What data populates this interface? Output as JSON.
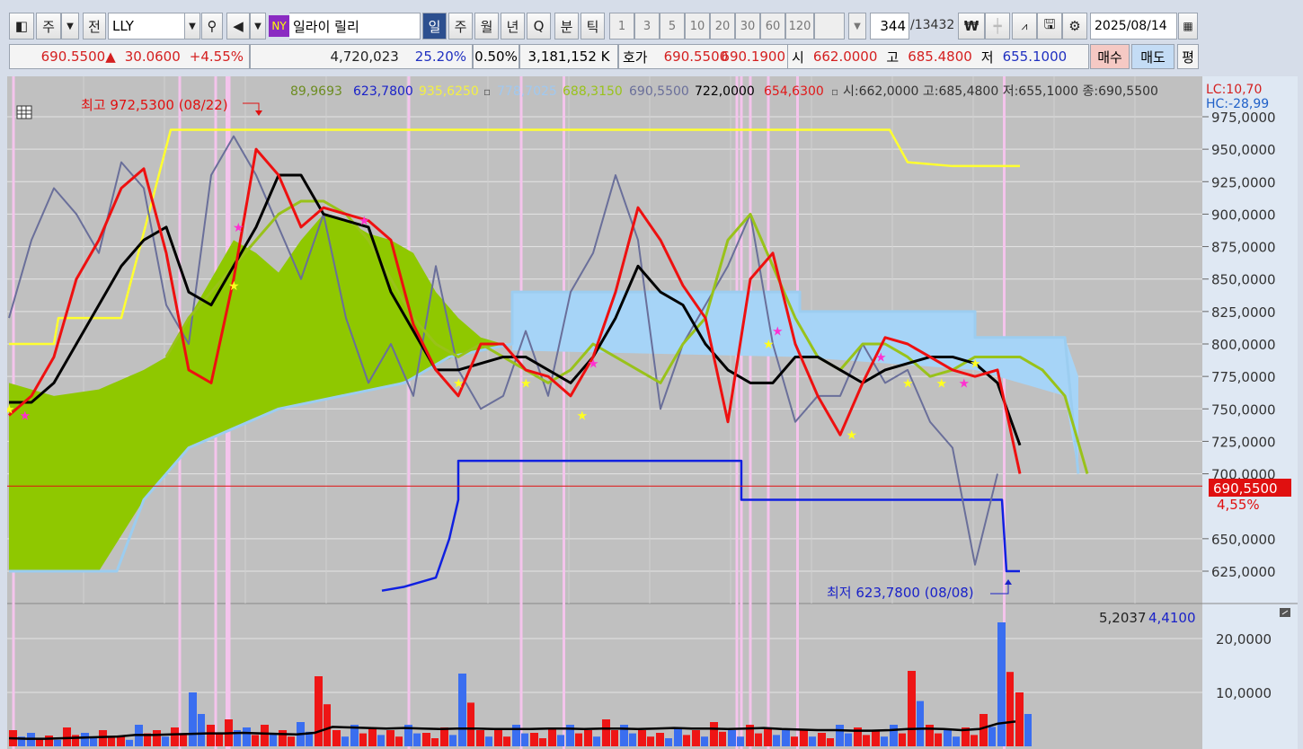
{
  "toolbar": {
    "period_label": "주",
    "prev_label": "전",
    "symbol": "LLY",
    "exchange_badge": "NY",
    "name": "일라이 릴리",
    "period_tabs": [
      "일",
      "주",
      "월",
      "년",
      "Q",
      "분",
      "틱"
    ],
    "intervals": [
      "1",
      "3",
      "5",
      "10",
      "20",
      "30",
      "60",
      "120"
    ],
    "count_value": "344",
    "count_total": "/13432",
    "currency_icon": "₩",
    "date": "2025/08/14"
  },
  "quote": {
    "price": "690.5500",
    "arrow": "▲",
    "change": "30.0600",
    "change_pct": "+4.55%",
    "volume": "4,720,023",
    "vol_ratio": "25.20%",
    "turnover": "0.50%",
    "amount": "3,181,152 K",
    "bid_label": "호가",
    "bid": "690.5500",
    "ask": "690.1900",
    "open_label": "시",
    "open": "662.0000",
    "high_label": "고",
    "high": "685.4800",
    "low_label": "저",
    "low": "655.1000",
    "buy_label": "매수",
    "sell_label": "매도",
    "avg_label": "평"
  },
  "legend": {
    "v1": "89,9693",
    "v2": "623,7800",
    "v3": "935,6250",
    "v4": "778,7025",
    "v5": "688,3150",
    "v6": "690,5500",
    "v7": "722,0000",
    "v8": "654,6300",
    "ohlc": "시:662,0000 고:685,4800 저:655,1000 종:690,5500",
    "lc": "LC:10,70",
    "hc": "HC:-28,99"
  },
  "annotations": {
    "high": "최고 972,5300 (08/22)",
    "low": "최저 623,7800 (08/08)",
    "price_tag": "690,5500",
    "price_pct": "4,55%",
    "vol_values_a": "5,2037",
    "vol_values_b": "4,4100"
  },
  "colors": {
    "price": "#ee1010",
    "ma": "#000000",
    "lagging": "#99c21a",
    "yellow": "#ffff30",
    "lowline": "#1020e0",
    "gray": "#6a6f9a",
    "span": "#9ccdf0",
    "cloud_green": "#8fc800",
    "cloud_blue": "#a6d4f7"
  },
  "chart_data": {
    "type": "line",
    "y_ticks": [
      "975,0000",
      "950,0000",
      "925,0000",
      "900,0000",
      "875,0000",
      "850,0000",
      "825,0000",
      "800,0000",
      "775,0000",
      "750,0000",
      "725,0000",
      "700,0000",
      "650,0000",
      "625,0000"
    ],
    "ylim": [
      610,
      1000
    ],
    "current_price": 690.55,
    "price": [
      745,
      760,
      790,
      850,
      880,
      920,
      935,
      870,
      780,
      770,
      850,
      950,
      930,
      890,
      905,
      900,
      895,
      880,
      815,
      780,
      760,
      800,
      800,
      780,
      775,
      760,
      790,
      840,
      905,
      880,
      845,
      820,
      740,
      850,
      870,
      800,
      760,
      730,
      770,
      805,
      800,
      790,
      780,
      775,
      780,
      700
    ],
    "ma": [
      755,
      755,
      770,
      800,
      830,
      860,
      880,
      890,
      840,
      830,
      860,
      890,
      930,
      930,
      900,
      895,
      890,
      840,
      810,
      780,
      780,
      785,
      790,
      790,
      780,
      770,
      790,
      820,
      860,
      840,
      830,
      800,
      780,
      770,
      770,
      790,
      790,
      780,
      770,
      780,
      785,
      790,
      790,
      785,
      770,
      722
    ],
    "lagging": [
      null,
      null,
      null,
      null,
      null,
      null,
      null,
      790,
      820,
      840,
      860,
      880,
      900,
      910,
      910,
      900,
      880,
      850,
      820,
      800,
      790,
      800,
      790,
      780,
      770,
      780,
      800,
      790,
      780,
      770,
      800,
      820,
      880,
      900,
      860,
      820,
      790,
      780,
      800,
      800,
      790,
      775,
      780,
      790,
      790,
      790,
      780,
      760,
      700
    ],
    "gray": [
      820,
      880,
      920,
      900,
      870,
      940,
      920,
      830,
      800,
      930,
      960,
      930,
      890,
      850,
      900,
      820,
      770,
      800,
      760,
      860,
      780,
      750,
      760,
      810,
      760,
      840,
      870,
      930,
      880,
      750,
      800,
      830,
      860,
      900,
      800,
      740,
      760,
      760,
      800,
      770,
      780,
      740,
      720,
      630,
      700
    ],
    "yellow": [
      [
        0,
        800
      ],
      [
        2,
        800
      ],
      [
        2.2,
        820
      ],
      [
        5,
        820
      ],
      [
        7.2,
        965
      ],
      [
        39.2,
        965
      ],
      [
        40,
        940
      ],
      [
        42,
        937
      ],
      [
        45,
        937
      ]
    ],
    "lowline": [
      [
        16.6,
        610
      ],
      [
        17.6,
        613
      ],
      [
        19,
        620
      ],
      [
        19.6,
        650
      ],
      [
        20,
        680
      ],
      [
        20,
        710
      ],
      [
        32.6,
        710
      ],
      [
        32.6,
        680
      ],
      [
        44.2,
        680
      ],
      [
        44.4,
        625
      ],
      [
        45,
        625
      ]
    ],
    "span": [
      [
        0,
        625
      ],
      [
        4.8,
        625
      ],
      [
        6,
        680
      ],
      [
        8,
        720
      ],
      [
        12,
        750
      ],
      [
        17.6,
        770
      ],
      [
        19.6,
        790
      ],
      [
        22.4,
        800
      ],
      [
        22.4,
        840
      ],
      [
        35.2,
        840
      ],
      [
        35.2,
        825
      ],
      [
        43,
        825
      ],
      [
        43,
        805
      ],
      [
        47,
        805
      ],
      [
        47.6,
        700
      ]
    ],
    "cloud_green_top": [
      [
        0,
        770
      ],
      [
        2,
        760
      ],
      [
        4,
        765
      ],
      [
        6,
        780
      ],
      [
        7,
        790
      ],
      [
        8,
        820
      ],
      [
        9,
        850
      ],
      [
        10,
        880
      ],
      [
        11,
        870
      ],
      [
        12,
        855
      ],
      [
        13,
        880
      ],
      [
        14,
        900
      ],
      [
        15,
        895
      ],
      [
        16,
        885
      ],
      [
        17,
        880
      ],
      [
        18,
        870
      ],
      [
        19,
        840
      ],
      [
        20,
        820
      ],
      [
        21,
        805
      ],
      [
        22,
        800
      ]
    ],
    "high_marker": [
      11.2,
      972.53
    ],
    "low_marker": [
      44.4,
      623.78
    ],
    "stars_yellow": [
      [
        0,
        750
      ],
      [
        10,
        845
      ],
      [
        20,
        770
      ],
      [
        23,
        770
      ],
      [
        25.5,
        745
      ],
      [
        33.8,
        800
      ],
      [
        37.5,
        730
      ],
      [
        40,
        770
      ],
      [
        41.5,
        770
      ],
      [
        43,
        785
      ]
    ],
    "stars_pink": [
      [
        0.7,
        745
      ],
      [
        10.2,
        890
      ],
      [
        15.8,
        895
      ],
      [
        26,
        785
      ],
      [
        34.2,
        810
      ],
      [
        38.8,
        790
      ],
      [
        42.5,
        770
      ]
    ],
    "pink_vlines": [
      0.2,
      7.6,
      9.2,
      9.7,
      9.8,
      17.8,
      22.8,
      24.7,
      32.4,
      32.6,
      33,
      33.8,
      35.1,
      44.3
    ],
    "volume": {
      "y_ticks": [
        "20,0000",
        "10,0000"
      ],
      "ylim": [
        0,
        25
      ],
      "values": [
        3,
        2.5,
        2,
        3.5,
        2.5,
        3,
        2,
        4,
        3,
        3.5,
        10,
        4,
        5,
        3.5,
        4,
        3,
        4.5,
        13,
        3,
        4,
        3.5,
        3,
        4,
        2.5,
        3.5,
        13.5,
        3,
        3,
        4,
        2.5,
        3.5,
        4,
        3,
        5,
        4,
        3,
        2.5,
        3.5,
        3,
        4.5,
        3,
        4,
        3.5,
        3,
        3,
        2.5,
        4,
        3.5,
        3,
        4,
        14,
        4,
        3,
        3.5,
        6,
        23,
        10
      ],
      "ma": [
        1.5,
        1.4,
        1.4,
        1.5,
        1.6,
        1.7,
        1.8,
        2.1,
        2.1,
        2.2,
        2.3,
        2.4,
        2.4,
        2.5,
        2.4,
        2.3,
        2.2,
        2.5,
        3.6,
        3.5,
        3.4,
        3.3,
        3.4,
        3.3,
        3.2,
        3.3,
        3.3,
        3.2,
        3.2,
        3.2,
        3.3,
        3.3,
        3.2,
        3.3,
        3.3,
        3.2,
        3.3,
        3.4,
        3.3,
        3.3,
        3.2,
        3.3,
        3.4,
        3.2,
        3.1,
        3,
        3,
        2.9,
        2.9,
        3,
        3.2,
        3.3,
        3.2,
        3,
        3.2,
        4.2,
        4.6
      ]
    }
  }
}
